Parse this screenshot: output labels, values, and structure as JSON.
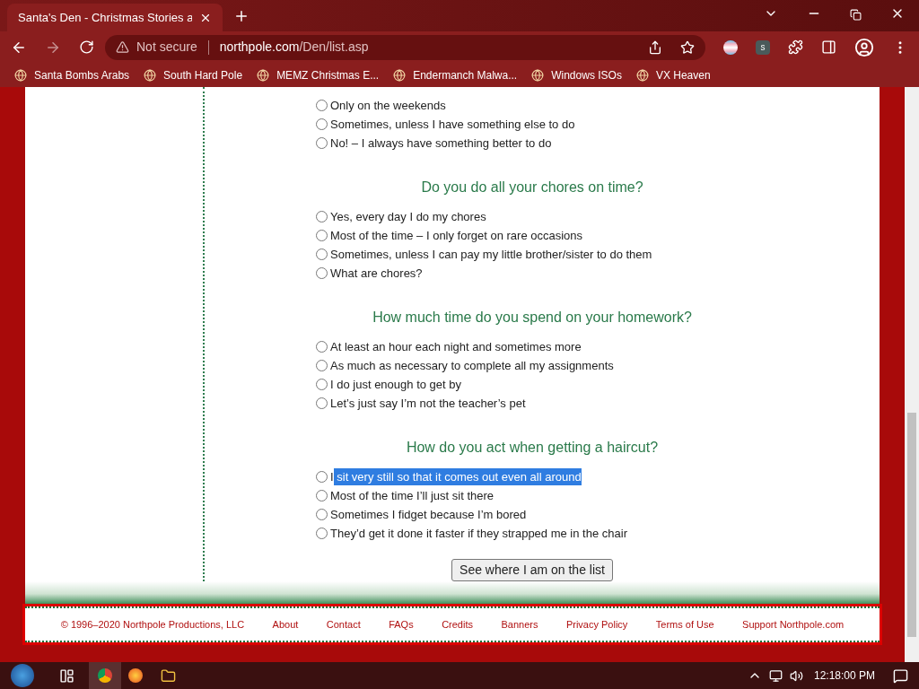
{
  "browser": {
    "tab_title": "Santa's Den - Christmas Stories a",
    "security": "Not secure",
    "url_host": "northpole.com",
    "url_path": "/Den/list.asp",
    "extension_letter": "s",
    "bookmarks": [
      "Santa Bombs Arabs",
      "South Hard Pole",
      "MEMZ Christmas E...",
      "Endermanch Malwa...",
      "Windows ISOs",
      "VX Heaven"
    ]
  },
  "questions": [
    {
      "answers": [
        {
          "text": "Only on the weekends",
          "selected": false
        },
        {
          "text": "Sometimes, unless I have something else to do",
          "selected": false
        },
        {
          "text": "No! – I always have something better to do",
          "selected": false
        }
      ]
    },
    {
      "title": "Do you do all your chores on time?",
      "answers": [
        {
          "text": "Yes, every day I do my chores",
          "selected": false
        },
        {
          "text": "Most of the time – I only forget on rare occasions",
          "selected": false
        },
        {
          "text": "Sometimes, unless I can pay my little brother/sister to do them",
          "selected": false
        },
        {
          "text": "What are chores?",
          "selected": false
        }
      ]
    },
    {
      "title": "How much time do you spend on your homework?",
      "answers": [
        {
          "text": "At least an hour each night and sometimes more",
          "selected": false
        },
        {
          "text": "As much as necessary to complete all my assignments",
          "selected": false
        },
        {
          "text": "I do just enough to get by",
          "selected": false
        },
        {
          "text": "Let’s just say I’m not the teacher’s pet",
          "selected": false
        }
      ]
    },
    {
      "title": "How do you act when getting a haircut?",
      "answers": [
        {
          "text": "I",
          "highlight": " sit very still so that it comes out even all around",
          "selected": false
        },
        {
          "text": "Most of the time I’ll just sit there",
          "selected": false
        },
        {
          "text": "Sometimes I fidget because I’m bored",
          "selected": false
        },
        {
          "text": "They’d get it done it faster if they strapped me in the chair",
          "selected": false
        }
      ]
    }
  ],
  "submit": "See where I am on the list",
  "footer": [
    "© 1996–2020 Northpole Productions, LLC",
    "About",
    "Contact",
    "FAQs",
    "Credits",
    "Banners",
    "Privacy Policy",
    "Terms of Use",
    "Support Northpole.com"
  ],
  "taskbar": {
    "time": "12:18:00 PM"
  }
}
